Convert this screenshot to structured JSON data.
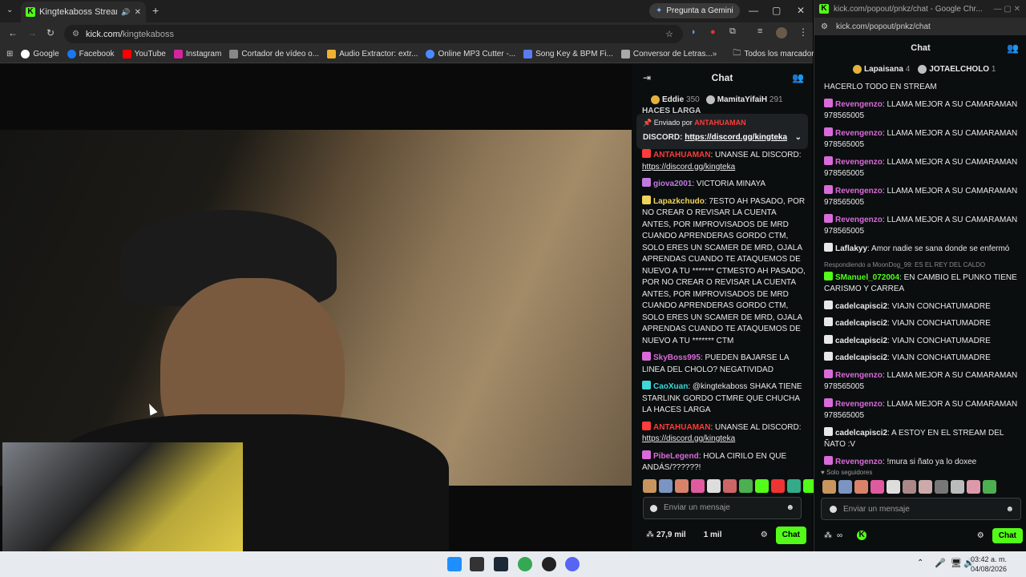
{
  "browser": {
    "tab_title": "Kingtekaboss Stream - Wat",
    "gemini_label": "Pregunta a Gemini",
    "url_host": "kick.com/",
    "url_path": "kingtekaboss",
    "bookmarks": [
      "Google",
      "Facebook",
      "YouTube",
      "Instagram",
      "Cortador de vídeo o...",
      "Audio Extractor: extr...",
      "Online MP3 Cutter -...",
      "Song Key & BPM Fi...",
      "Conversor de Letras..."
    ],
    "bookmarks_folder": "Todos los marcadores"
  },
  "chat": {
    "title": "Chat",
    "leaderboard": [
      {
        "name": "Eddie",
        "count": "350"
      },
      {
        "name": "MamitaYifaiH",
        "count": "291"
      }
    ],
    "pinned": {
      "sent_by": "Enviado por",
      "sender": "ANTAHUAMAN",
      "prefix": "DISCORD:",
      "link": "https://discord.gg/kingteka"
    },
    "cut_top": "HACES LARGA",
    "messages": [
      {
        "user": "ANTAHUAMAN",
        "color": "#ff3b3b",
        "text": ": UNANSE AL DISCORD:",
        "link": "https://discord.gg/kingteka"
      },
      {
        "user": "giova2001",
        "color": "#c07ae0",
        "text": ": VICTORIA MINAYA"
      },
      {
        "user": "Lapazkchudo",
        "color": "#f2d35a",
        "text": ": 7ESTO AH PASADO, POR NO CREAR O REVISAR LA CUENTA ANTES, POR IMPROVISADOS DE MRD CUANDO APRENDERAS GORDO CTM, SOLO ERES UN SCAMER DE MRD, OJALA APRENDAS CUANDO TE ATAQUEMOS DE NUEVO A TU ******* CTMESTO AH PASADO, POR NO CREAR O REVISAR LA CUENTA ANTES, POR IMPROVISADOS DE MRD CUANDO APRENDERAS GORDO CTM, SOLO ERES UN SCAMER DE MRD, OJALA APRENDAS CUANDO TE ATAQUEMOS DE NUEVO A TU ******* CTM"
      },
      {
        "user": "SkyBoss995",
        "color": "#d96ad9",
        "text": ": PUEDEN BAJARSE LA LINEA DEL CHOLO? NEGATIVIDAD"
      },
      {
        "user": "CaoXuan",
        "color": "#3fd7d7",
        "text": ": @kingtekaboss SHAKA TIENE STARLINK GORDO CTMRE QUE CHUCHA LA HACES LARGA"
      },
      {
        "user": "ANTAHUAMAN",
        "color": "#ff3b3b",
        "text": ": UNANSE AL DISCORD:",
        "link": "https://discord.gg/kingteka"
      },
      {
        "user": "PibeLegend",
        "color": "#d96ad9",
        "text": ": HOLA CIRILO EN QUE ANDÁS/??????!"
      }
    ],
    "input_placeholder": "Enviar un mensaje",
    "viewers": "27,9 mil",
    "followers": "1 mil",
    "chat_button": "Chat"
  },
  "popout": {
    "window_title": "kick.com/popout/pnkz/chat - Google Chr...",
    "url": "kick.com/popout/pnkz/chat",
    "title": "Chat",
    "leaderboard": [
      {
        "name": "Lapaisana",
        "count": "4"
      },
      {
        "name": "JOTAELCHOLO",
        "count": "1"
      }
    ],
    "messages": [
      {
        "user": "",
        "color": "#e8e8e8",
        "text": "HACERLO TODO EN STREAM"
      },
      {
        "user": "Revengenzo",
        "color": "#d96ad9",
        "text": ": LLAMA MEJOR A SU CAMARAMAN 978565005"
      },
      {
        "user": "Revengenzo",
        "color": "#d96ad9",
        "text": ": LLAMA MEJOR A SU CAMARAMAN 978565005"
      },
      {
        "user": "Revengenzo",
        "color": "#d96ad9",
        "text": ": LLAMA MEJOR A SU CAMARAMAN 978565005"
      },
      {
        "user": "Revengenzo",
        "color": "#d96ad9",
        "text": ": LLAMA MEJOR A SU CAMARAMAN 978565005"
      },
      {
        "user": "Revengenzo",
        "color": "#d96ad9",
        "text": ": LLAMA MEJOR A SU CAMARAMAN 978565005"
      },
      {
        "user": "Laflakyy",
        "color": "#e8e8e8",
        "text": ": Amor nadie se sana donde se enfermó"
      },
      {
        "reply": "Respondiendo a MoonDog_99: ES EL REY DEL CALDO"
      },
      {
        "user": "SManuel_072004",
        "color": "#53fc18",
        "text": ": EN CAMBIO EL PUNKO TIENE CARISMO Y CARREA"
      },
      {
        "user": "cadelcapisci2",
        "color": "#e8e8e8",
        "text": ": VIAJN CONCHATUMADRE"
      },
      {
        "user": "cadelcapisci2",
        "color": "#e8e8e8",
        "text": ": VIAJN CONCHATUMADRE"
      },
      {
        "user": "cadelcapisci2",
        "color": "#e8e8e8",
        "text": ": VIAJN CONCHATUMADRE"
      },
      {
        "user": "cadelcapisci2",
        "color": "#e8e8e8",
        "text": ": VIAJN CONCHATUMADRE"
      },
      {
        "user": "Revengenzo",
        "color": "#d96ad9",
        "text": ": LLAMA MEJOR A SU CAMARAMAN 978565005"
      },
      {
        "user": "Revengenzo",
        "color": "#d96ad9",
        "text": ": LLAMA MEJOR A SU CAMARAMAN 978565005"
      },
      {
        "user": "cadelcapisci2",
        "color": "#e8e8e8",
        "text": ": A ESTOY EN EL STREAM DEL ÑATO :V"
      },
      {
        "user": "Revengenzo",
        "color": "#d96ad9",
        "text": ": !mura si ñato ya lo doxee"
      }
    ],
    "followers_only": "Solo seguidores",
    "input_placeholder": "Enviar un mensaje",
    "chat_button": "Chat"
  },
  "taskbar": {
    "time": "03:42 a. m.",
    "date": "04/08/2026"
  },
  "colors": {
    "kick_green": "#53fc18"
  }
}
